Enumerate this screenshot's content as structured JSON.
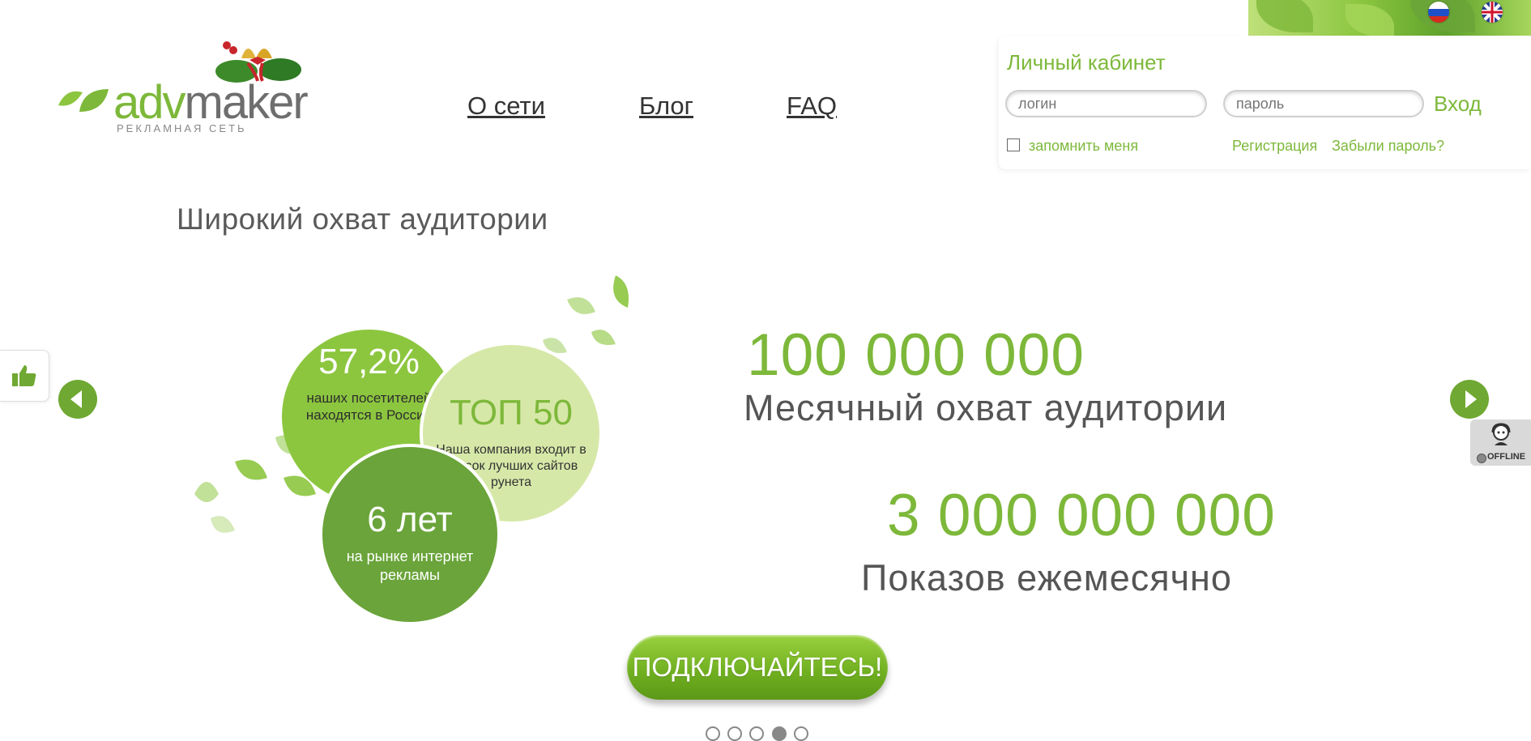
{
  "logo": {
    "brand_adv": "adv",
    "brand_maker": "maker",
    "subtitle": "РЕКЛАМНАЯ СЕТЬ"
  },
  "nav": {
    "items": [
      "О сети",
      "Блог",
      "FAQ"
    ]
  },
  "login": {
    "title": "Личный кабинет",
    "login_placeholder": "логин",
    "password_placeholder": "пароль",
    "submit_label": "Вход",
    "remember_label": "запомнить меня",
    "register_link": "Регистрация",
    "forgot_link": "Забыли пароль?"
  },
  "slider": {
    "heading": "Широкий охват аудитории",
    "circles": [
      {
        "value": "57,2%",
        "text": "наших посетителей находятся в России",
        "color": "#8cc63f"
      },
      {
        "value": "ТОП 50",
        "text": "Наша компания входит в список лучших сайтов рунета",
        "color": "#d6e8a8"
      },
      {
        "value": "6 лет",
        "text": "на рынке интернет рекламы",
        "color": "#6aa43a"
      }
    ],
    "stats": [
      {
        "value": "100 000 000",
        "label": "Месячный охват аудитории"
      },
      {
        "value": "3 000 000 000",
        "label": "Показов ежемесячно"
      }
    ],
    "cta_label": "ПОДКЛЮЧАЙТЕСЬ!",
    "dots_total": 5,
    "active_dot": 4
  },
  "widgets": {
    "offline_label": "OFFLINE"
  },
  "colors": {
    "accent": "#7db83a",
    "dark_green": "#6aa43a",
    "text": "#444444"
  },
  "icons": [
    "thumbs-up-icon",
    "arrow-left-icon",
    "arrow-right-icon",
    "russian-flag-icon",
    "english-flag-icon",
    "support-agent-icon",
    "christmas-bells-icon",
    "leaf-icon"
  ]
}
